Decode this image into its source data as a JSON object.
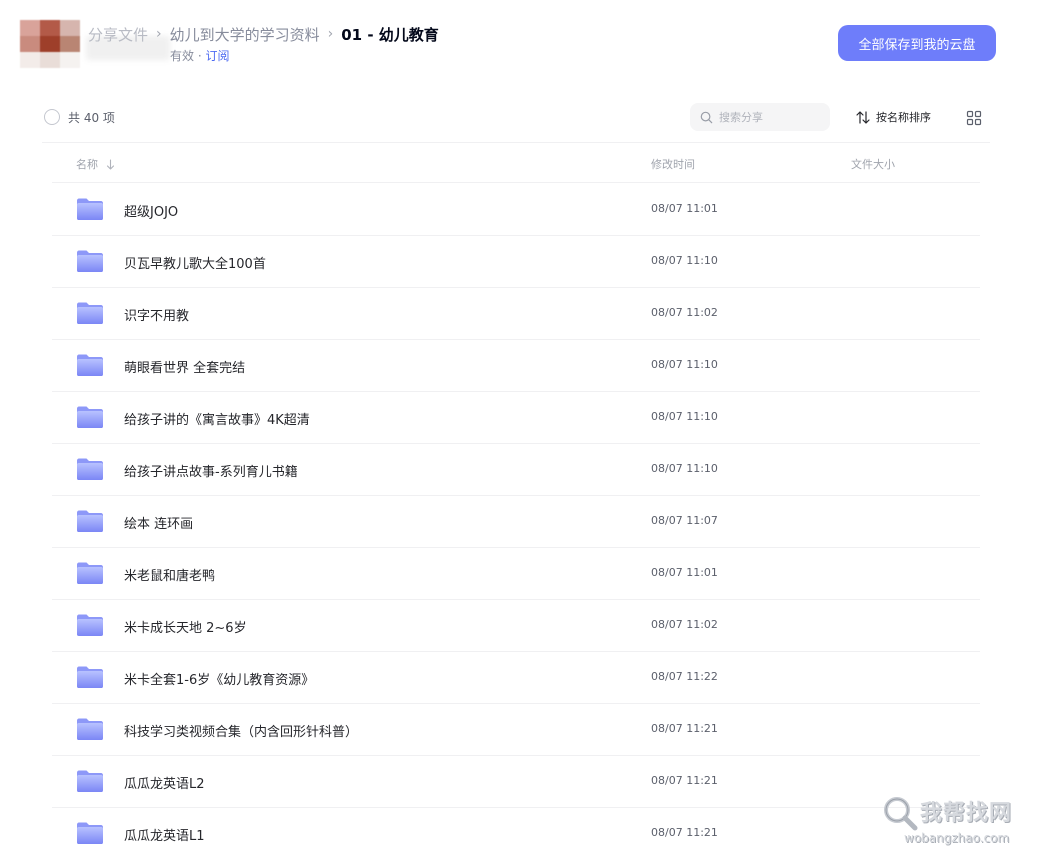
{
  "breadcrumb": {
    "root": "分享文件",
    "parent": "幼儿到大学的学习资料",
    "current": "01 - 幼儿教育"
  },
  "share_info": {
    "validity": "有效 ·",
    "subscribe": "订阅"
  },
  "save_button": "全部保存到我的云盘",
  "toolbar": {
    "count": "共 40 项",
    "search_placeholder": "搜索分享",
    "sort_label": "按名称排序"
  },
  "columns": {
    "name": "名称",
    "modified": "修改时间",
    "size": "文件大小"
  },
  "files": [
    {
      "name": "超级JOJO",
      "time": "08/07 11:01"
    },
    {
      "name": "贝瓦早教儿歌大全100首",
      "time": "08/07 11:10"
    },
    {
      "name": "识字不用教",
      "time": "08/07 11:02"
    },
    {
      "name": "萌眼看世界 全套完结",
      "time": "08/07 11:10"
    },
    {
      "name": "给孩子讲的《寓言故事》4K超清",
      "time": "08/07 11:10"
    },
    {
      "name": "给孩子讲点故事-系列育儿书籍",
      "time": "08/07 11:10"
    },
    {
      "name": "绘本 连环画",
      "time": "08/07 11:07"
    },
    {
      "name": "米老鼠和唐老鸭",
      "time": "08/07 11:01"
    },
    {
      "name": "米卡成长天地 2~6岁",
      "time": "08/07 11:02"
    },
    {
      "name": "米卡全套1-6岁《幼儿教育资源》",
      "time": "08/07 11:22"
    },
    {
      "name": "科技学习类视频合集（内含回形针科普）",
      "time": "08/07 11:21"
    },
    {
      "name": "瓜瓜龙英语L2",
      "time": "08/07 11:21"
    },
    {
      "name": "瓜瓜龙英语L1",
      "time": "08/07 11:21"
    }
  ],
  "watermark": {
    "title": "我帮找网",
    "domain": "wobangzhao.com"
  },
  "colors": {
    "accent": "#6e7dfa",
    "link": "#4e6bf2",
    "folder_light": "#b8c2ff",
    "folder_dark": "#7b86f5"
  }
}
